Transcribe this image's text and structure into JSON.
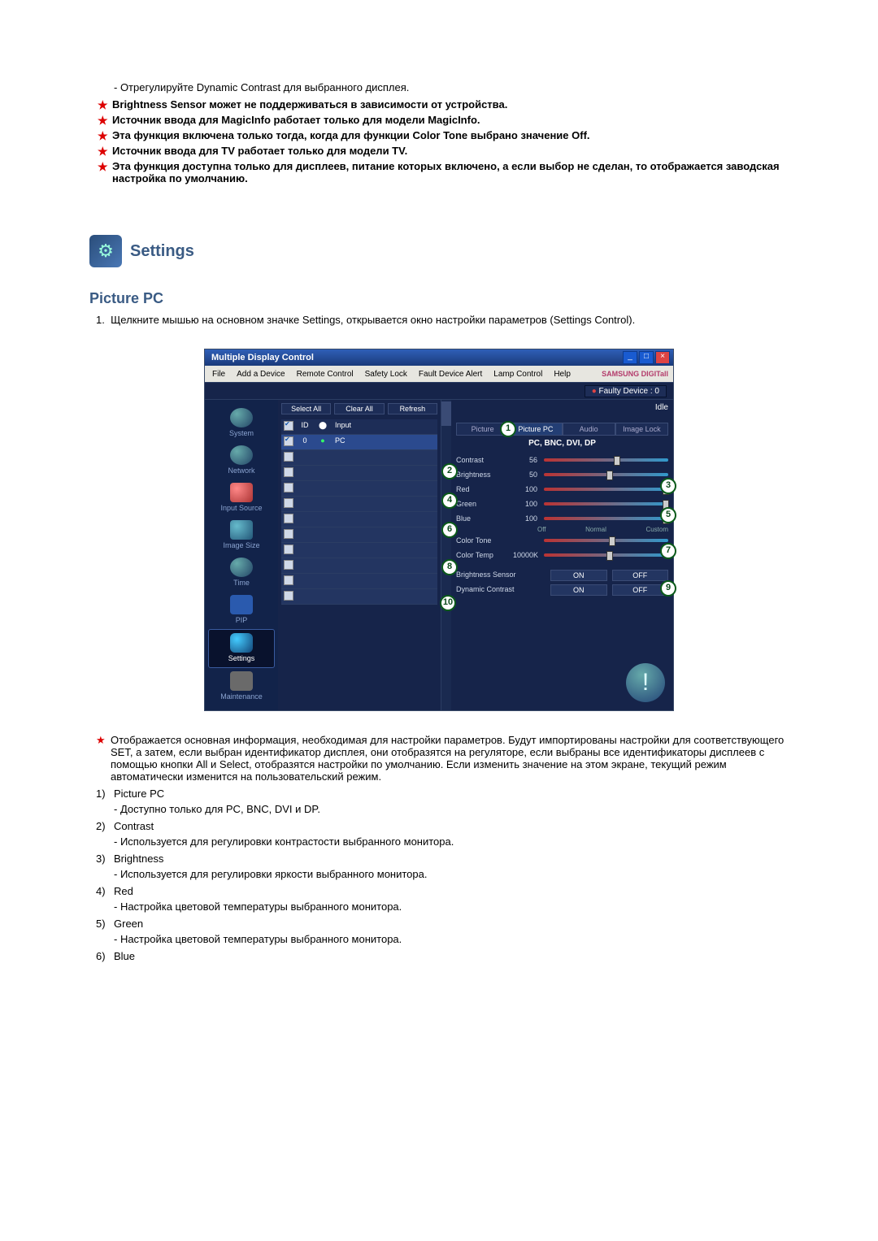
{
  "top_dash_note": "- Отрегулируйте Dynamic Contrast для выбранного дисплея.",
  "stars": [
    "Brightness Sensor может не поддерживаться в зависимости от устройства.",
    "Источник ввода для MagicInfo работает только для модели MagicInfo.",
    "Эта функция включена только тогда, когда для функции Color Tone выбрано значение Off.",
    "Источник ввода для TV работает только для модели TV.",
    "Эта функция доступна только для дисплеев, питание которых включено, а если выбор не сделан, то отображается заводская настройка по умолчанию."
  ],
  "settings_heading": "Settings",
  "picture_pc_heading": "Picture PC",
  "step1": "Щелкните мышью на основном значке Settings, открывается окно настройки параметров (Settings Control).",
  "app": {
    "title": "Multiple Display Control",
    "menus": [
      "File",
      "Add a Device",
      "Remote Control",
      "Safety Lock",
      "Fault Device Alert",
      "Lamp Control",
      "Help"
    ],
    "brand": "SAMSUNG DIGITall",
    "faulty": "Faulty Device : 0",
    "sidebar": [
      "System",
      "Network",
      "Input Source",
      "Image Size",
      "Time",
      "PIP",
      "Settings",
      "Maintenance"
    ],
    "toolbar": [
      "Select All",
      "Clear All",
      "Refresh"
    ],
    "grid_head": [
      "ID",
      "",
      "Input"
    ],
    "grid_row": {
      "id": "0",
      "input": "PC"
    },
    "idle": "Idle",
    "tabs": [
      "Picture",
      "Picture PC",
      "Audio",
      "Image Lock"
    ],
    "subhead": "PC, BNC, DVI, DP",
    "sliders": [
      {
        "label": "Contrast",
        "val": "56",
        "pos": 56
      },
      {
        "label": "Brightness",
        "val": "50",
        "pos": 50
      },
      {
        "label": "Red",
        "val": "100",
        "pos": 100
      },
      {
        "label": "Green",
        "val": "100",
        "pos": 100
      },
      {
        "label": "Blue",
        "val": "100",
        "pos": 100
      }
    ],
    "color_tone": {
      "label": "Color Tone",
      "opts": [
        "Off",
        "Normal",
        "Custom"
      ],
      "pos": 52
    },
    "color_temp": {
      "label": "Color Temp",
      "val": "10000K",
      "pos": 50
    },
    "brightness_sensor": {
      "label": "Brightness Sensor",
      "on": "ON",
      "off": "OFF"
    },
    "dynamic_contrast": {
      "label": "Dynamic Contrast",
      "on": "ON",
      "off": "OFF"
    }
  },
  "info_text": "Отображается основная информация, необходимая для настройки параметров. Будут импортированы настройки для соответствующего SET, а затем, если выбран идентификатор дисплея, они отобразятся на регуляторе, если выбраны все идентификаторы дисплеев с помощью кнопки All и Select, отобразятся настройки по умолчанию. Если изменить значение на этом экране, текущий режим автоматически изменится на пользовательский режим.",
  "items": [
    {
      "n": "1)",
      "t": "Picture PC",
      "d": "- Доступно только для PC, BNC, DVI и DP."
    },
    {
      "n": "2)",
      "t": "Contrast",
      "d": "- Используется для регулировки контрастости выбранного монитора."
    },
    {
      "n": "3)",
      "t": "Brightness",
      "d": "- Используется для регулировки яркости выбранного монитора."
    },
    {
      "n": "4)",
      "t": "Red",
      "d": "- Настройка цветовой температуры выбранного монитора."
    },
    {
      "n": "5)",
      "t": "Green",
      "d": "- Настройка цветовой температуры выбранного монитора."
    },
    {
      "n": "6)",
      "t": "Blue",
      "d": ""
    }
  ]
}
